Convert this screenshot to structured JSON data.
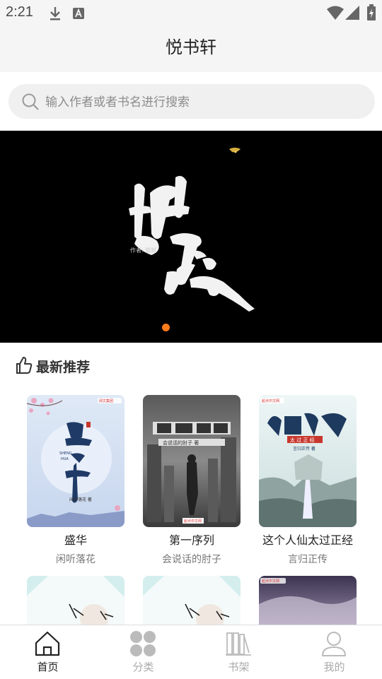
{
  "status_bar": {
    "time": "2:21"
  },
  "header": {
    "title": "悦书轩"
  },
  "search": {
    "placeholder": "输入作者或者书名进行搜索"
  },
  "banner": {
    "active_index": 0,
    "count": 1
  },
  "section": {
    "title": "最新推荐"
  },
  "books": [
    {
      "title": "盛华",
      "author": "闲听落花"
    },
    {
      "title": "第一序列",
      "author": "会说话的肘子"
    },
    {
      "title": "这个人仙太过正经",
      "author": "言归正传"
    }
  ],
  "tabs": [
    {
      "label": "首页",
      "icon": "home-icon",
      "active": true
    },
    {
      "label": "分类",
      "icon": "grid-icon",
      "active": false
    },
    {
      "label": "书架",
      "icon": "bookshelf-icon",
      "active": false
    },
    {
      "label": "我的",
      "icon": "user-icon",
      "active": false
    }
  ],
  "colors": {
    "accent": "#ff7a1a",
    "header_bg": "#f5f5f5",
    "active_tab": "#222222",
    "inactive_tab": "#aaaaaa"
  }
}
